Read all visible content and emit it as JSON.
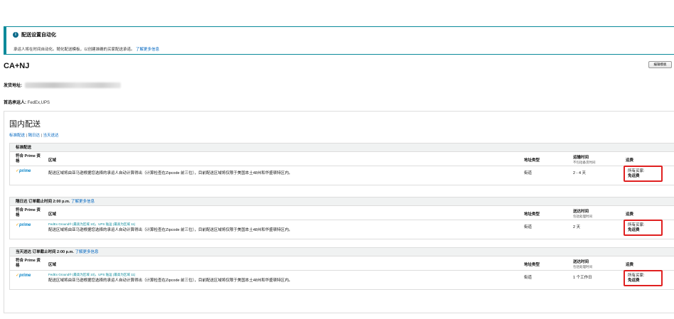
{
  "alert": {
    "title": "配送设置自动化",
    "description": "承运人将在时间自动化。随化配送模板，以创建准确的买家配送承诺。",
    "link": "了解更多信息"
  },
  "template": {
    "name": "CA+NJ",
    "edit_button": "编辑模板"
  },
  "ship_from": {
    "label": "发货地址:"
  },
  "carrier": {
    "label": "首选承运人:",
    "value": "FedEx,UPS"
  },
  "domestic": {
    "heading": "国内配送",
    "nav": [
      "标准配送",
      "隔日达",
      "当天送达"
    ]
  },
  "columns": {
    "prime": "符合 Prime 资格",
    "region": "区域",
    "address_type": "地址类型",
    "shipping_fee": "运费"
  },
  "sections": [
    {
      "title": "标准配送",
      "title_link": "",
      "time_header": "运输时间",
      "time_sub": "不包括备货时间",
      "row": {
        "prime": "prime",
        "carrier_note": "",
        "region": "配送区域将由亚马逊根据您选择的承运人自动计算得出（计算检查在Zipcode 前三位），目前配送区域将仅限于美国本土48州和华盛顿特区内。",
        "address_type": "街道",
        "time": "2 - 4 天",
        "fee_line1": "所有买家:",
        "fee_line2": "免运费"
      }
    },
    {
      "title": "隔日达 订单截止时间 2:00 p.m.",
      "title_link": "了解更多信息",
      "time_header": "送达时间",
      "time_sub": "包括处理时间",
      "row": {
        "prime": "prime",
        "carrier_note": "FedEx Ground® (最高为区域 10)，UPS 陆运 (最高为区域 11)",
        "region": "配送区域将由亚马逊根据您选择的承运人自动计算得出（计算检查在Zipcode 前三位），目前配送区域将仅限于美国本土48州和华盛顿特区内。",
        "address_type": "街道",
        "time": "2 天",
        "fee_line1": "所有买家:",
        "fee_line2": "免运费"
      }
    },
    {
      "title": "当天送达 订单截止时间 2:00 p.m.",
      "title_link": "了解更多信息",
      "time_header": "送达时间",
      "time_sub": "包括处理时间",
      "row": {
        "prime": "prime",
        "carrier_note": "FedEx Ground® (最高为区域 10)，UPS 陆运 (最高为区域 11)",
        "region": "配送区域将由亚马逊根据您选择的承运人自动计算得出（计算检查在Zipcode 前三位），目前配送区域将仅限于美国本土48州和华盛顿特区内。",
        "address_type": "街道",
        "time": "1 个工作日",
        "fee_line1": "所有买家:",
        "fee_line2": "免运费"
      }
    }
  ]
}
